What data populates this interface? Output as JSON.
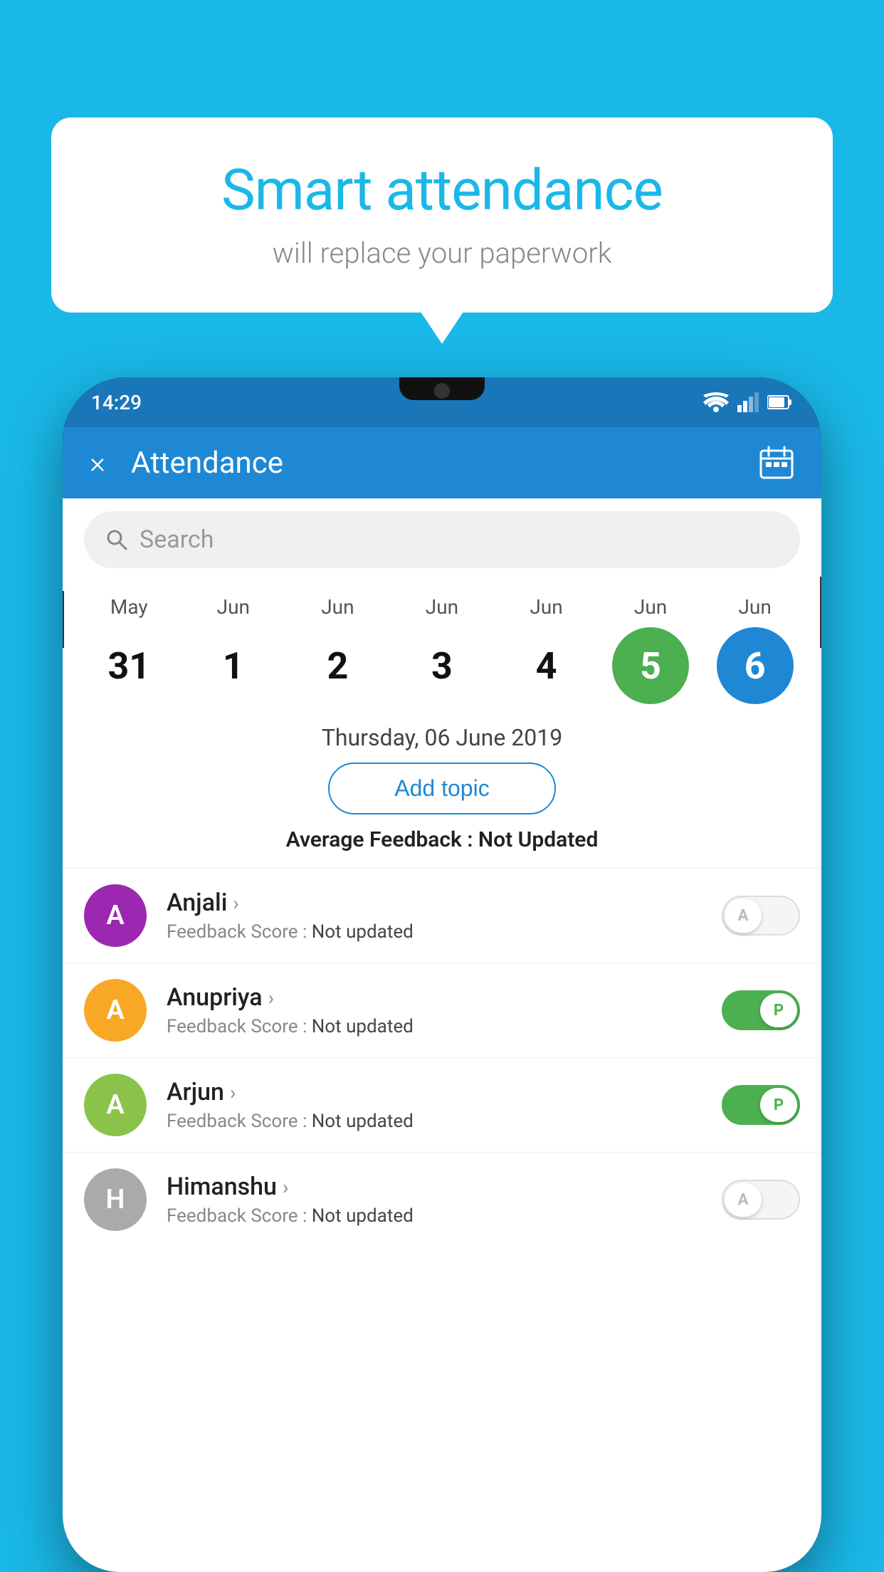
{
  "background": "#1ab8e8",
  "speech_bubble": {
    "title": "Smart attendance",
    "subtitle": "will replace your paperwork"
  },
  "app": {
    "status_bar": {
      "time": "14:29"
    },
    "app_bar": {
      "title": "Attendance",
      "close_label": "×",
      "calendar_icon": "calendar-icon"
    },
    "search": {
      "placeholder": "Search"
    },
    "calendar": {
      "columns": [
        {
          "month": "May",
          "day": "31",
          "highlight": "none"
        },
        {
          "month": "Jun",
          "day": "1",
          "highlight": "none"
        },
        {
          "month": "Jun",
          "day": "2",
          "highlight": "none"
        },
        {
          "month": "Jun",
          "day": "3",
          "highlight": "none"
        },
        {
          "month": "Jun",
          "day": "4",
          "highlight": "none"
        },
        {
          "month": "Jun",
          "day": "5",
          "highlight": "green"
        },
        {
          "month": "Jun",
          "day": "6",
          "highlight": "blue"
        }
      ]
    },
    "selected_date": "Thursday, 06 June 2019",
    "add_topic_label": "Add topic",
    "average_feedback_label": "Average Feedback :",
    "average_feedback_value": "Not Updated",
    "students": [
      {
        "name": "Anjali",
        "avatar_letter": "A",
        "avatar_color": "#9c27b0",
        "feedback_label": "Feedback Score :",
        "feedback_value": "Not updated",
        "toggle_on": false,
        "toggle_letter": "A"
      },
      {
        "name": "Anupriya",
        "avatar_letter": "A",
        "avatar_color": "#f9a825",
        "feedback_label": "Feedback Score :",
        "feedback_value": "Not updated",
        "toggle_on": true,
        "toggle_letter": "P"
      },
      {
        "name": "Arjun",
        "avatar_letter": "A",
        "avatar_color": "#8bc34a",
        "feedback_label": "Feedback Score :",
        "feedback_value": "Not updated",
        "toggle_on": true,
        "toggle_letter": "P"
      },
      {
        "name": "Himanshu",
        "avatar_letter": "H",
        "avatar_color": "#aaa",
        "feedback_label": "Feedback Score :",
        "feedback_value": "Not updated",
        "toggle_on": false,
        "toggle_letter": "A"
      }
    ]
  }
}
